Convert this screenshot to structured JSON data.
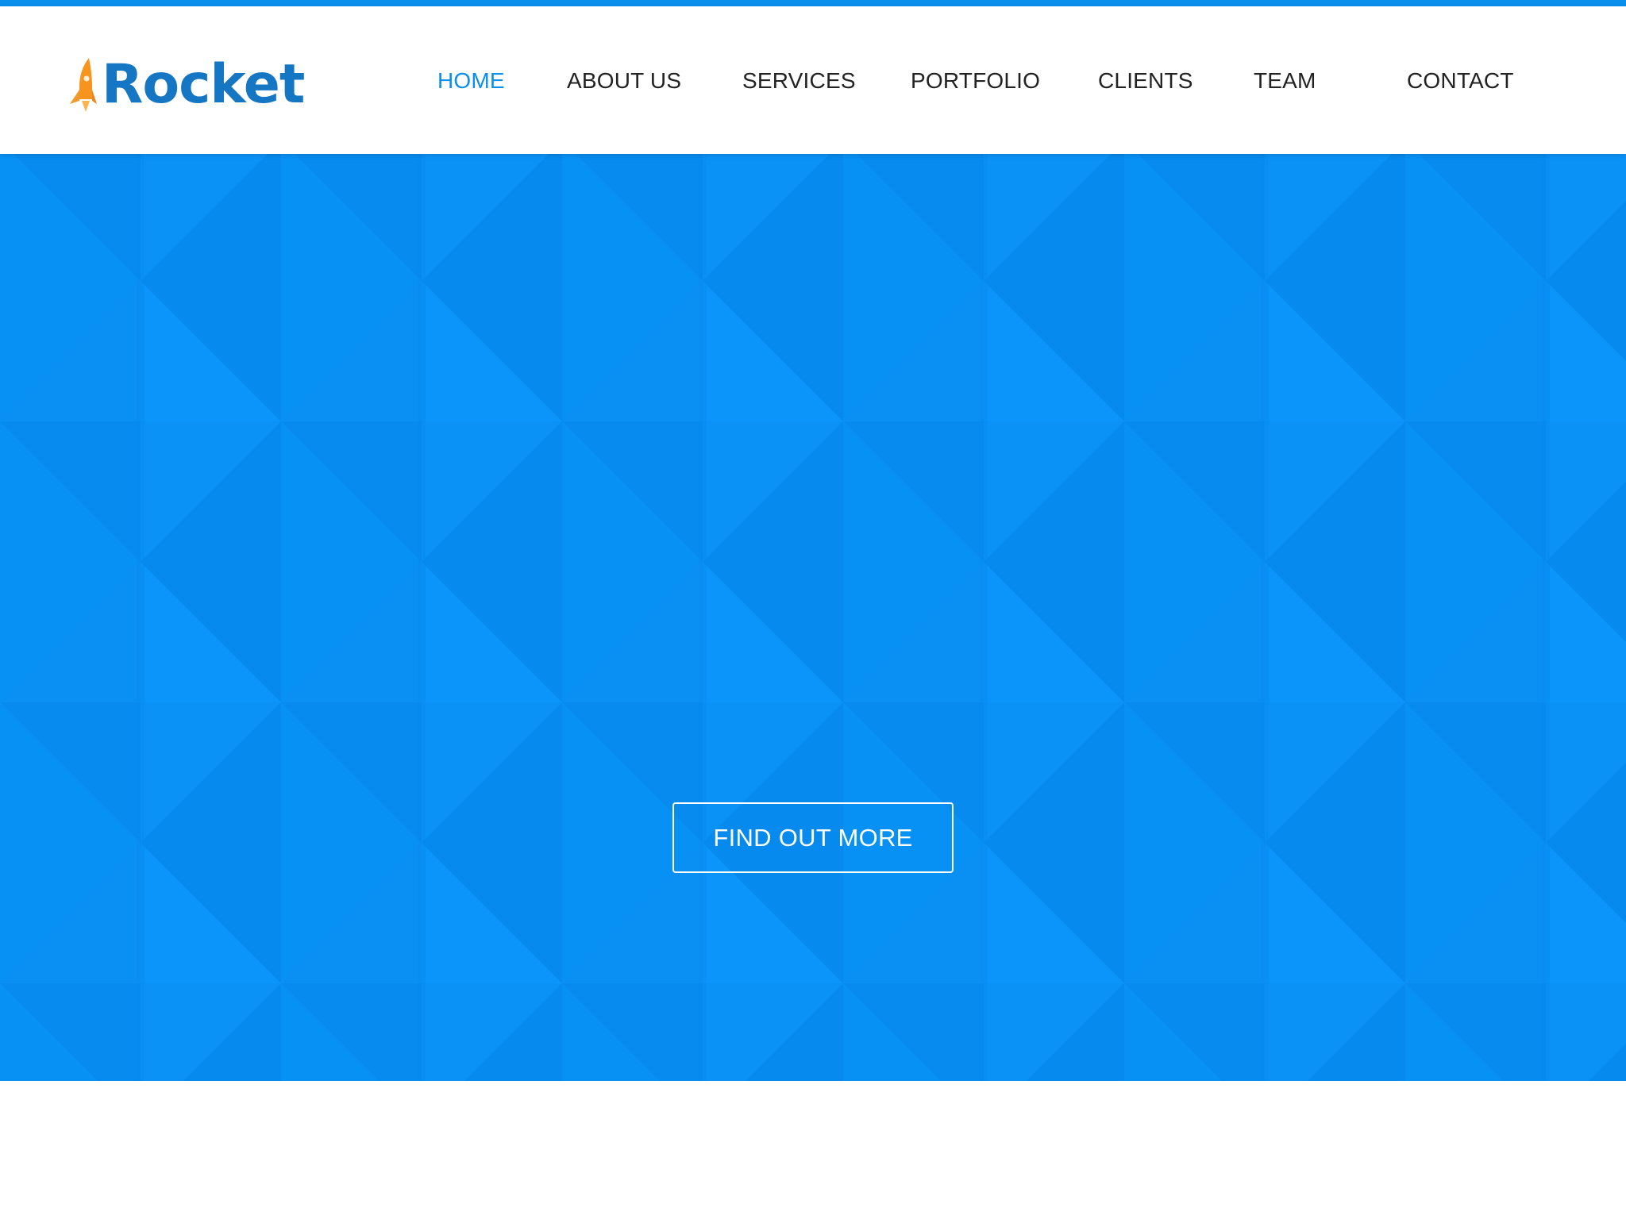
{
  "brand": {
    "name": "Rocket",
    "text_color": "#1576c4",
    "icon": "rocket-icon",
    "icon_color": "#f7941d"
  },
  "nav": {
    "items": [
      {
        "label": "HOME",
        "active": true
      },
      {
        "label": "ABOUT US",
        "active": false
      },
      {
        "label": "SERVICES",
        "active": false
      },
      {
        "label": "PORTFOLIO",
        "active": false
      },
      {
        "label": "CLIENTS",
        "active": false
      },
      {
        "label": "TEAM",
        "active": false
      },
      {
        "label": "CONTACT",
        "active": false
      }
    ],
    "active_color": "#0a8fee",
    "text_color": "#222222"
  },
  "hero": {
    "background_color": "#0a90f6",
    "cta_label": "FIND OUT MORE"
  },
  "colors": {
    "accent": "#0a8fee",
    "header_bg": "#ffffff"
  }
}
